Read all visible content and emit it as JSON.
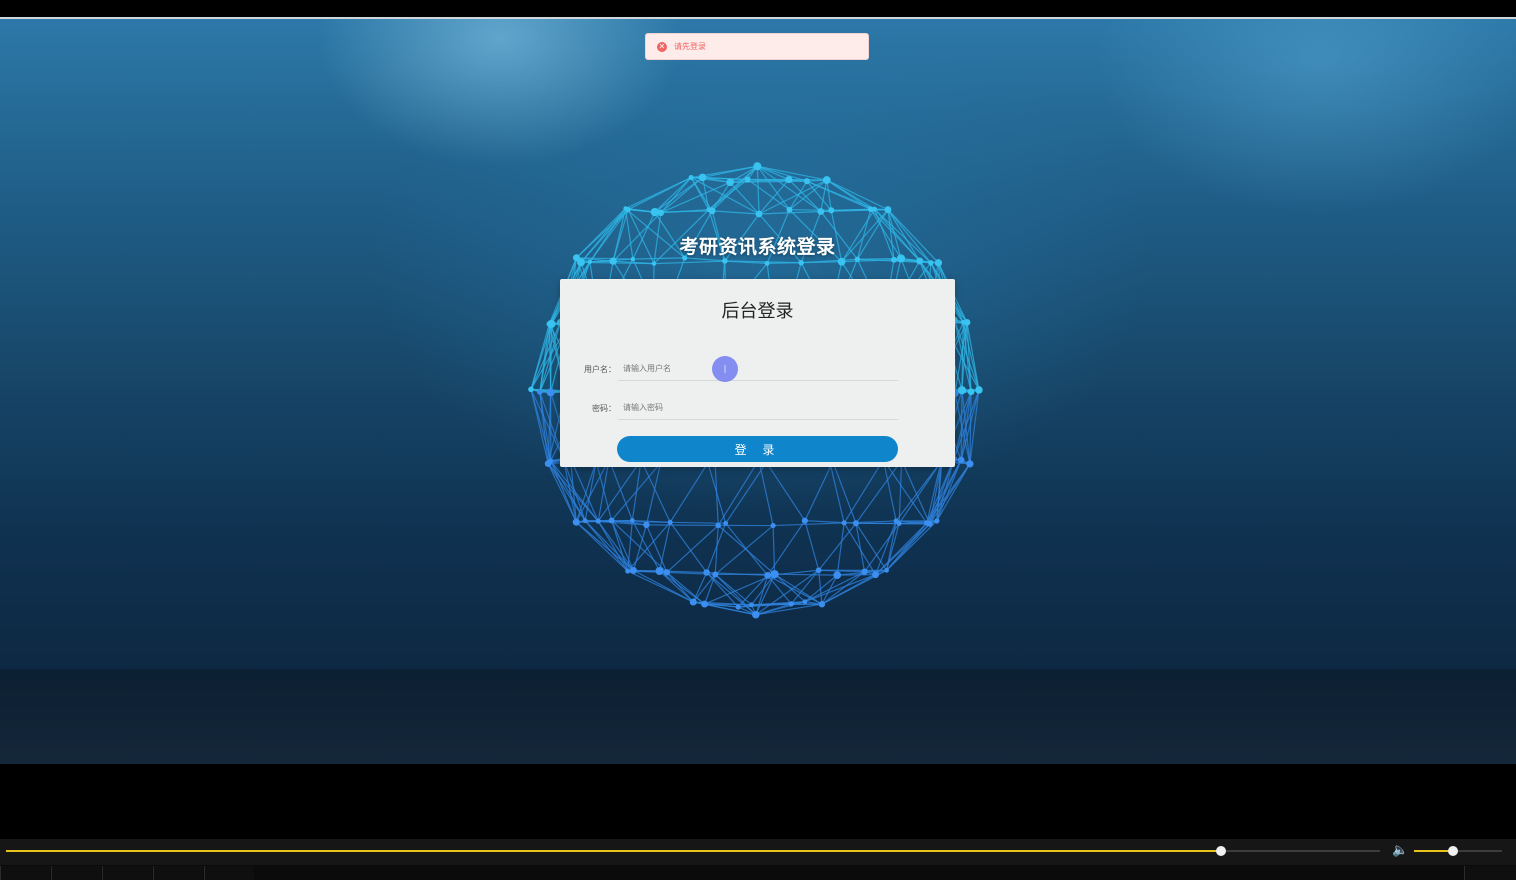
{
  "toast": {
    "icon": "error-circle-icon",
    "text": "请先登录",
    "color": "#f06363"
  },
  "system_title": "考研资讯系统登录",
  "login_card": {
    "title": "后台登录",
    "username": {
      "label": "用户名：",
      "placeholder": "请输入用户名",
      "value": ""
    },
    "password": {
      "label": "密码：",
      "placeholder": "请输入密码",
      "value": ""
    },
    "submit_label": "登 录",
    "accent": "#0f85cc"
  },
  "cursor": {
    "glyph": "I"
  },
  "player": {
    "progress_fraction": 0.884,
    "volume_fraction": 0.44,
    "volume_icon": "speaker-icon",
    "accent": "#e8c21a"
  }
}
